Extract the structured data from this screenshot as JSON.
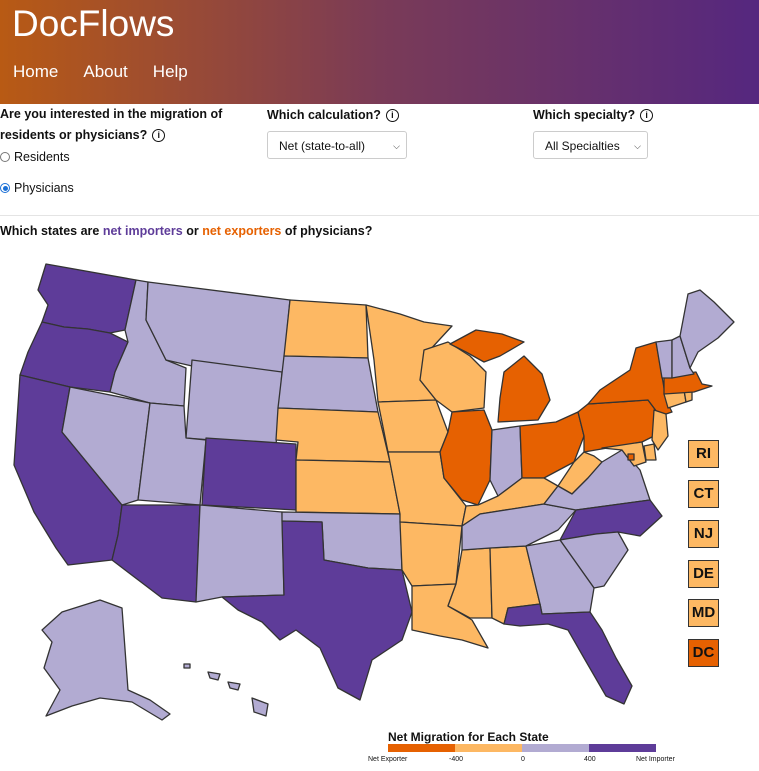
{
  "header": {
    "brand": "DocFlows",
    "nav": [
      "Home",
      "About",
      "Help"
    ]
  },
  "controls": {
    "q1": "Are you interested in the migration of residents or physicians?",
    "q1_line1": "Are you interested in the migration of",
    "q1_line2": "residents or physicians?",
    "radios": [
      {
        "label": "Residents",
        "selected": false
      },
      {
        "label": "Physicians",
        "selected": true
      }
    ],
    "q2": "Which calculation?",
    "calc_value": "Net (state-to-all)",
    "q3": "Which specialty?",
    "spec_value": "All Specialties",
    "info_icon": "i"
  },
  "map_question": {
    "pre": "Which states are",
    "importers": "net importers",
    "mid": "or",
    "exporters": "net exporters",
    "post": "of physicians?"
  },
  "colors": {
    "strong_exporter": "#e66101",
    "exporter": "#fdb863",
    "importer": "#b2abd2",
    "strong_importer": "#5e3c99"
  },
  "small_states": [
    {
      "abbr": "RI",
      "cat": "exporter"
    },
    {
      "abbr": "CT",
      "cat": "exporter"
    },
    {
      "abbr": "NJ",
      "cat": "exporter"
    },
    {
      "abbr": "DE",
      "cat": "exporter"
    },
    {
      "abbr": "MD",
      "cat": "exporter"
    },
    {
      "abbr": "DC",
      "cat": "strong_exporter"
    }
  ],
  "state_categories": {
    "WA": "strong_importer",
    "OR": "strong_importer",
    "CA": "strong_importer",
    "AZ": "strong_importer",
    "CO": "strong_importer",
    "TX": "strong_importer",
    "NC": "strong_importer",
    "FL": "strong_importer",
    "ID": "importer",
    "MT": "importer",
    "WY": "importer",
    "NV": "importer",
    "UT": "importer",
    "NM": "importer",
    "SD": "importer",
    "OK": "importer",
    "IN": "importer",
    "TN": "importer",
    "GA": "importer",
    "SC": "importer",
    "VA": "importer",
    "VT": "importer",
    "NH": "importer",
    "ME": "importer",
    "AK": "importer",
    "HI": "importer",
    "ND": "exporter",
    "MN": "exporter",
    "NE": "exporter",
    "KS": "exporter",
    "IA": "exporter",
    "WI": "exporter",
    "MO": "exporter",
    "AR": "exporter",
    "LA": "exporter",
    "MS": "exporter",
    "AL": "exporter",
    "KY": "exporter",
    "WV": "exporter",
    "CT": "exporter",
    "NJ": "exporter",
    "MD": "exporter",
    "DE": "exporter",
    "RI": "exporter",
    "MI": "strong_exporter",
    "IL": "strong_exporter",
    "OH": "strong_exporter",
    "PA": "strong_exporter",
    "NY": "strong_exporter",
    "MA": "strong_exporter",
    "DC": "strong_exporter"
  },
  "legend": {
    "title": "Net Migration for Each State",
    "ticks": [
      "Net Exporter",
      "-400",
      "0",
      "400",
      "Net Importer"
    ]
  }
}
